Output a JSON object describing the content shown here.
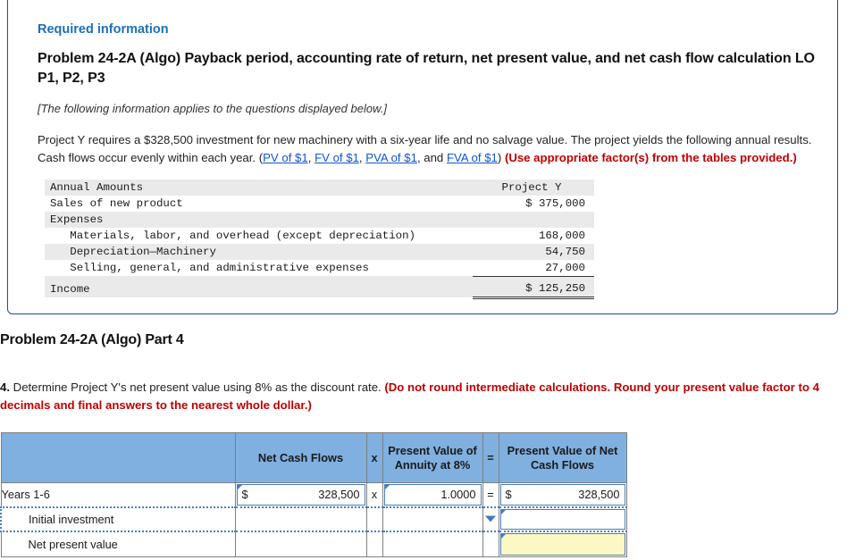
{
  "alert": {
    "icon": "exclamation-icon",
    "glyph": "!"
  },
  "card": {
    "required_label": "Required information",
    "problem_title": "Problem 24-2A (Algo) Payback period, accounting rate of return, net present value, and net cash flow calculation LO P1, P2, P3",
    "applies_note": "[The following information applies to the questions displayed below.]",
    "paragraph": {
      "part1": "Project Y requires a $328,500 investment for new machinery with a six-year life and no salvage value. The project yields the following annual results. Cash flows occur evenly within each year. (",
      "links": [
        "PV of $1",
        "FV of $1",
        "PVA of $1",
        "FVA of $1"
      ],
      "sep1": ", ",
      "sep2": ", ",
      "sep3": ", and ",
      "close": ") ",
      "red_note": "(Use appropriate factor(s) from the tables provided.)"
    }
  },
  "fin_table": {
    "header": {
      "label": "Annual Amounts",
      "col": "Project Y"
    },
    "rows": [
      {
        "label": "Sales of new product",
        "value": "$ 375,000"
      },
      {
        "label": "Expenses",
        "value": ""
      },
      {
        "label": "   Materials, labor, and overhead (except depreciation)",
        "value": "168,000"
      },
      {
        "label": "   Depreciation—Machinery",
        "value": "54,750"
      },
      {
        "label": "   Selling, general, and administrative expenses",
        "value": "27,000"
      },
      {
        "label": "Income",
        "value": "$ 125,250"
      }
    ]
  },
  "part4": {
    "heading": "Problem 24-2A (Algo) Part 4",
    "question_num": "4.",
    "question_text": " Determine Project Y's net present value using 8% as the discount rate. ",
    "question_red": "(Do not round intermediate calculations. Round your present value factor to 4 decimals and final answers to the nearest whole dollar.)"
  },
  "answer_table": {
    "headers": {
      "blank": "",
      "net_cash_flows": "Net Cash Flows",
      "times": "x",
      "pv_annuity": "Present Value of Annuity at 8%",
      "equals": "=",
      "pv_net_cash_flows": "Present Value of Net Cash Flows"
    },
    "rows": [
      {
        "label": "Years 1-6",
        "ncf_dollar": "$",
        "ncf_value": "328,500",
        "op1": "x",
        "pva_value": "1.0000",
        "op2": "=",
        "pvncf_dollar": "$",
        "pvncf_value": "328,500"
      },
      {
        "label": "Initial investment",
        "ncf_dollar": "",
        "ncf_value": "",
        "op1": "",
        "pva_value": "",
        "op2": "",
        "pvncf_dollar": "",
        "pvncf_value": ""
      },
      {
        "label": "Net present value",
        "ncf_dollar": "",
        "ncf_value": "",
        "op1": "",
        "pva_value": "",
        "op2": "",
        "pvncf_dollar": "",
        "pvncf_value": ""
      }
    ]
  },
  "colors": {
    "card_border": "#1d4e89",
    "badge": "#1c4e88",
    "req_title": "#1d6fb8",
    "red_note": "#c00000",
    "link": "#1155cc",
    "table_header_blue": "#7fb0e0",
    "input_border": "#4a7ebb",
    "answer_yellow": "#fbf8c3"
  }
}
